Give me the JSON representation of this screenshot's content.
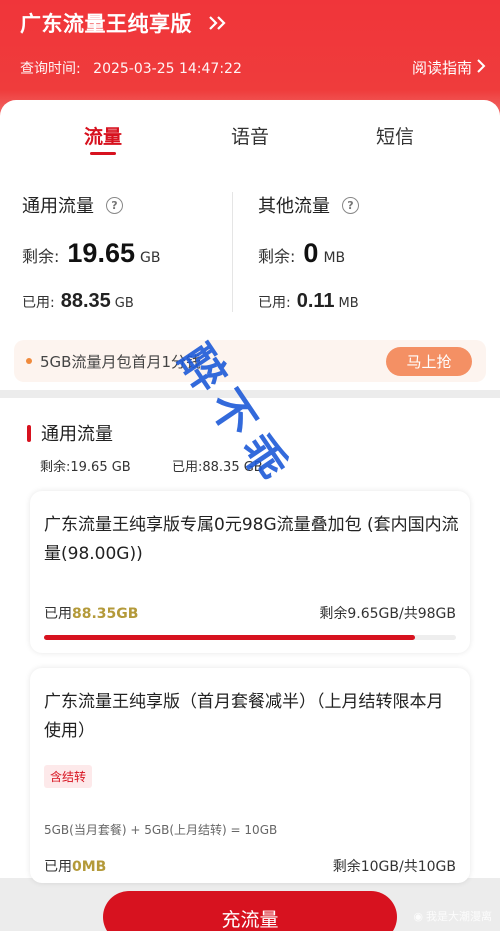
{
  "header": {
    "title": "广东流量王纯享版",
    "query_label": "查询时间:",
    "query_time": "2025-03-25 14:47:22",
    "guide_label": "阅读指南"
  },
  "tabs": [
    {
      "label": "流量",
      "active": true
    },
    {
      "label": "语音",
      "active": false
    },
    {
      "label": "短信",
      "active": false
    }
  ],
  "summary": {
    "general": {
      "title": "通用流量",
      "remain_label": "剩余:",
      "remain_value": "19.65",
      "remain_unit": "GB",
      "used_label": "已用:",
      "used_value": "88.35",
      "used_unit": "GB"
    },
    "other": {
      "title": "其他流量",
      "remain_label": "剩余:",
      "remain_value": "0",
      "remain_unit": "MB",
      "used_label": "已用:",
      "used_value": "0.11",
      "used_unit": "MB"
    }
  },
  "promo": {
    "text": "5GB流量月包首月1分钱",
    "button": "马上抢"
  },
  "section": {
    "title": "通用流量",
    "remain_summary": "剩余:19.65 GB",
    "used_summary": "已用:88.35 GB"
  },
  "packages": [
    {
      "name": "广东流量王纯享版专属0元98G流量叠加包 (套内国内流量(98.00G))",
      "used_label": "已用",
      "used_value": "88.35GB",
      "remain": "剩余9.65GB/共98GB",
      "progress": 0.9
    },
    {
      "name": "广东流量王纯享版（首月套餐减半）（上月结转限本月使用）",
      "tag": "含结转",
      "formula": "5GB(当月套餐) + 5GB(上月结转) = 10GB",
      "used_label": "已用",
      "used_value": "0MB",
      "remain": "剩余10GB/共10GB"
    }
  ],
  "bottom_button": "充流量",
  "watermark_text": "醉不乖",
  "source_mark": "我是大潮漫离",
  "colors": {
    "brand_red": "#d7121f",
    "header_red": "#f0353a",
    "promo_orange": "#f49064",
    "watermark_blue": "#1e5ad8",
    "used_gold": "#b49a3a"
  }
}
